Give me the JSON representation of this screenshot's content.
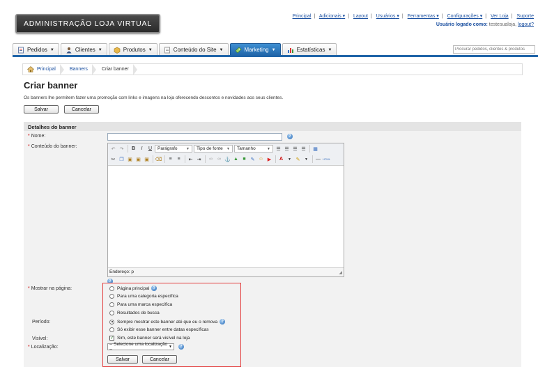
{
  "header": {
    "logo_text": "ADMINISTRAÇÃO LOJA VIRTUAL",
    "links": [
      "Principal",
      "Adicionais",
      "Layout",
      "Usuários",
      "Ferramentas",
      "Configurações",
      "Ver Loja",
      "Suporte"
    ],
    "user_prefix": "Usuário logado como:",
    "user_name": "testesualoja,",
    "logout": "logout?"
  },
  "nav": {
    "tabs": [
      {
        "label": "Pedidos",
        "icon": "orders-icon"
      },
      {
        "label": "Clientes",
        "icon": "customers-icon"
      },
      {
        "label": "Produtos",
        "icon": "products-icon"
      },
      {
        "label": "Conteúdo do Site",
        "icon": "content-icon"
      },
      {
        "label": "Marketing",
        "icon": "marketing-icon",
        "active": true
      },
      {
        "label": "Estatísticas",
        "icon": "stats-icon"
      }
    ],
    "search_placeholder": "Procurar pedidos, clientes & produtos"
  },
  "breadcrumb": [
    "Principal",
    "Banners",
    "Criar banner"
  ],
  "page": {
    "title": "Criar banner",
    "intro": "Os banners lhe permitem fazer uma promoção com links e imagens na loja oferecendo descontos e novidades aos seus clientes.",
    "save": "Salvar",
    "cancel": "Cancelar"
  },
  "form": {
    "section_title": "Detalhes do banner",
    "name_label": "Nome:",
    "content_label": "Conteúdo do banner:",
    "editor": {
      "format": "Parágrafo",
      "font": "Tipo de fonte",
      "size": "Tamanho",
      "status": "Endereço: p"
    },
    "show_label": "Mostrar na página:",
    "show_options": [
      "Página principal",
      "Para uma categoria específica",
      "Para uma marca específica",
      "Resultados de busca"
    ],
    "period_label": "Período:",
    "period_options": [
      "Sempre mostrar este banner até que eu o remova",
      "Só exibir esse banner entre datas específicas"
    ],
    "visible_label": "Visível:",
    "visible_text": "Sim, este banner será visível na loja",
    "location_label": "Localização:",
    "location_value": "-- Selecione uma localização --",
    "save": "Salvar",
    "cancel": "Cancelar"
  }
}
